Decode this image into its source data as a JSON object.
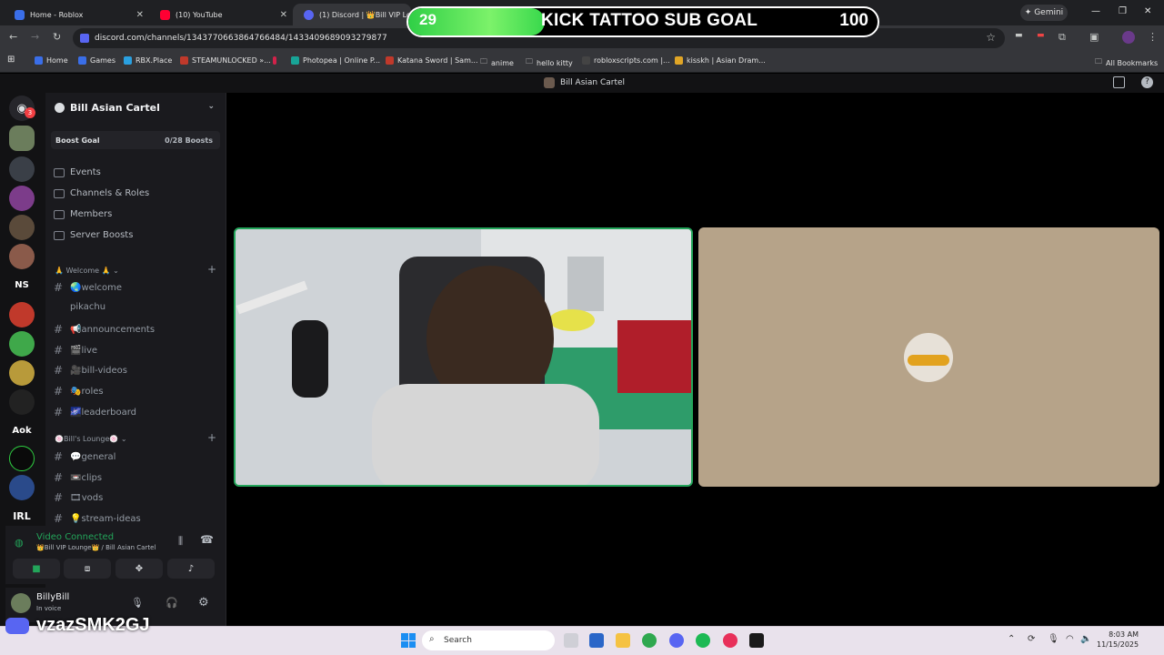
{
  "browser": {
    "tabs": [
      {
        "title": "Home - Roblox",
        "active": false
      },
      {
        "title": "(10) YouTube",
        "active": false
      },
      {
        "title": "(1) Discord | 👑Bill VIP Lou",
        "active": true
      }
    ],
    "gemini_label": "Gemini",
    "url": "discord.com/channels/1343770663864766484/1433409689093279877",
    "bookmarks": [
      "Home",
      "Games",
      "RBX.Place",
      "STEAMUNLOCKED »...",
      "Photopea | Online P...",
      "Katana Sword | Sam...",
      "anime",
      "hello kitty",
      "robloxscripts.com |...",
      "kisskh | Asian Dram..."
    ],
    "all_bookmarks": "All Bookmarks"
  },
  "goal_overlay": {
    "current": "29",
    "title": "KICK TATTOO SUB GOAL",
    "target": "100",
    "progress_fraction": 0.29
  },
  "discord": {
    "top_title": "Bill Asian Cartel",
    "server_name": "Bill Asian Cartel",
    "rail_badge": "3",
    "rail_text_items": [
      "NS",
      "Aok",
      "IRL"
    ],
    "boost_goal_label": "Boost Goal",
    "boost_goal_count": "0/28 Boosts",
    "menu": [
      "Events",
      "Channels & Roles",
      "Members",
      "Server Boosts"
    ],
    "category1": "🙏 Welcome 🙏",
    "channels1": [
      {
        "name": "🌏welcome",
        "hash": true
      },
      {
        "name": "pikachu",
        "hash": false
      },
      {
        "name": "📢announcements",
        "hash": true
      },
      {
        "name": "🎬live",
        "hash": true
      },
      {
        "name": "🎥bill-videos",
        "hash": true
      },
      {
        "name": "🎭roles",
        "hash": true
      },
      {
        "name": "🌌leaderboard",
        "hash": true
      }
    ],
    "category2": "🍥Bill's Lounge🍥",
    "channels2": [
      {
        "name": "💬general",
        "hash": true
      },
      {
        "name": "📼clips",
        "hash": true
      },
      {
        "name": "🎞vods",
        "hash": true
      },
      {
        "name": "💡stream-ideas",
        "hash": true
      }
    ],
    "voice_status": "Video Connected",
    "voice_channel": "👑Bill VIP Lounge👑 / Bill Asian Cartel",
    "user_name": "BillyBill",
    "user_status": "In voice"
  },
  "watermark": "vzazSMK2GJ",
  "taskbar": {
    "search_placeholder": "Search",
    "time": "8:03 AM",
    "date": "11/15/2025"
  }
}
